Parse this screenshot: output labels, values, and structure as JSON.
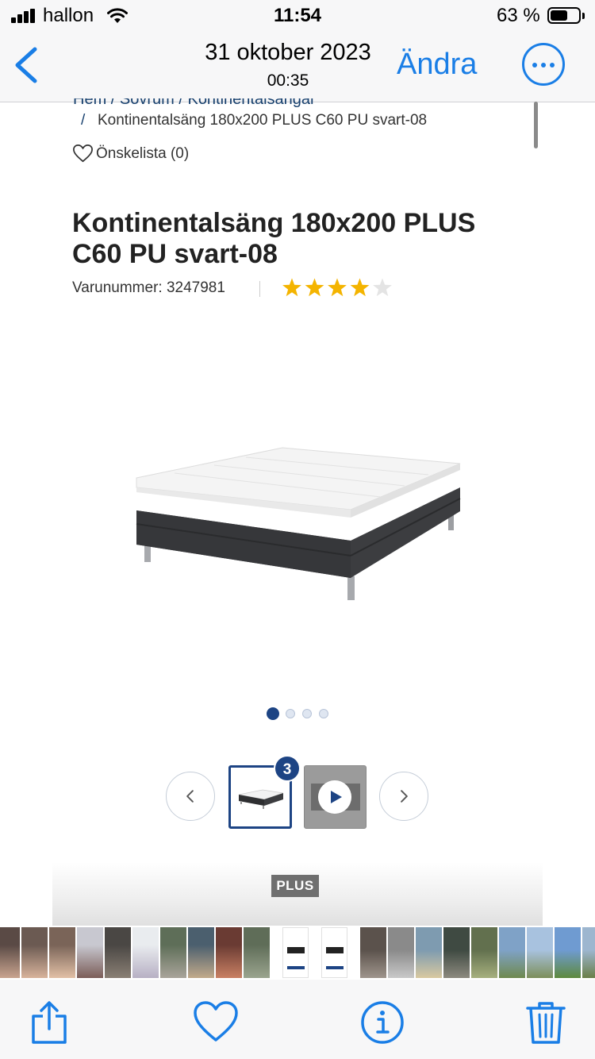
{
  "status_bar": {
    "carrier": "hallon",
    "time": "11:54",
    "battery_percent": "63 %",
    "battery_level": 0.63
  },
  "nav": {
    "back_icon": "chevron-left-icon",
    "date": "31 oktober 2023",
    "time": "00:35",
    "edit_label": "Ändra",
    "more_icon": "ellipsis-circle-icon",
    "accent_color": "#1a7ee6"
  },
  "page": {
    "breadcrumb_cut": "Hem  /  Sovrum  /  Kontinentalsängar",
    "breadcrumb_sep": "/",
    "breadcrumb_current": "Kontinentalsäng 180x200 PLUS C60 PU svart-08",
    "wishlist_label": "Önskelista (0)",
    "title": "Kontinentalsäng 180x200 PLUS C60 PU svart-08",
    "sku": "Varunummer: 3247981",
    "rating_value": 4,
    "rating_max": 5,
    "star_color": "#f4b400",
    "gallery_dots_total": 4,
    "gallery_dot_active": 1,
    "thumb_badge": "3",
    "plus_badge": "PLUS",
    "brand_color": "#1d4484"
  },
  "photo_strip": {
    "count": 22
  },
  "toolbar": {
    "share_icon": "share-icon",
    "favorite_icon": "heart-icon",
    "info_icon": "info-icon",
    "delete_icon": "trash-icon"
  }
}
